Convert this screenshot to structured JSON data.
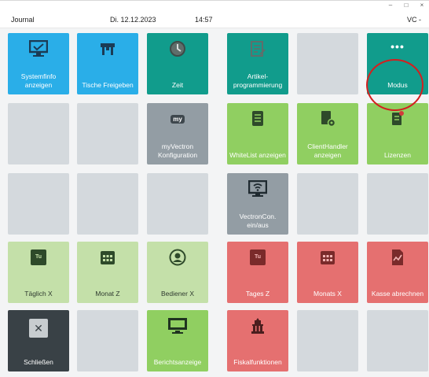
{
  "window": {
    "minimize": "–",
    "maximize": "□",
    "close": "×"
  },
  "header": {
    "app": "Journal",
    "date": "Di. 12.12.2023",
    "time": "14:57",
    "user": "VC -"
  },
  "tiles": {
    "systeminfo": "Systemfinfo anzeigen",
    "tische": "Tische Freigeben",
    "zeit": "Zeit",
    "artikel": "Artikel-programmierung",
    "modus": "Modus",
    "myvectron": "myVectron Konfiguration",
    "whitelist": "WhiteList anzeigen",
    "clienthandler": "ClientHandler anzeigen",
    "lizenzen": "Lizenzen",
    "vectroncon": "VectronCon. ein/aus",
    "taeglich": "Täglich X",
    "monatz": "Monat Z",
    "bediener": "Bediener X",
    "tagesz": "Tages Z",
    "monatsx": "Monats X",
    "kasse": "Kasse abrechnen",
    "schliessen": "Schließen",
    "berichtsanzeige": "Berichtsanzeige",
    "fiskal": "Fiskalfunktionen"
  },
  "icons": {
    "modus_dots": "•••",
    "tu": "Tu",
    "close_x": "✕",
    "my": "my"
  },
  "colors": {
    "blue": "#2aaee8",
    "teal": "#119c8c",
    "gray": "#d4d9dd",
    "slate": "#939da4",
    "green": "#90cf61",
    "pale_green": "#c4e0a9",
    "red": "#e57070",
    "dark": "#394146",
    "annotation": "#d41f1f"
  }
}
